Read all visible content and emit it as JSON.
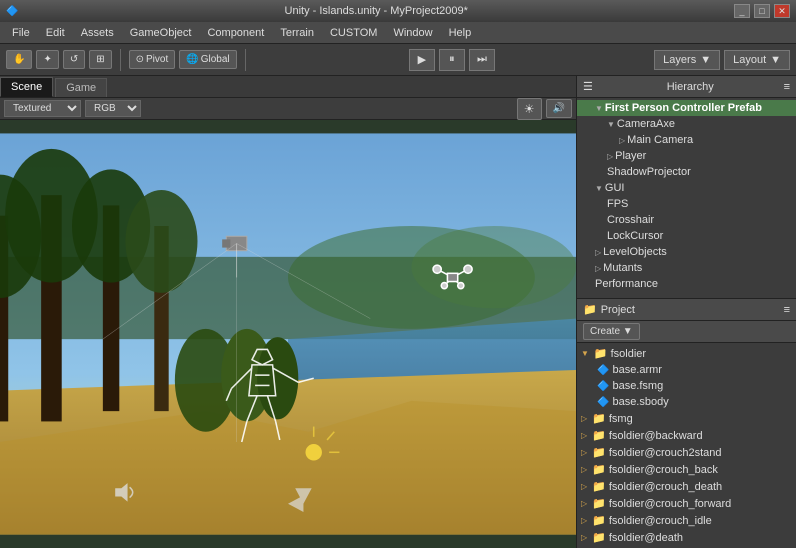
{
  "titlebar": {
    "title": "Unity - Islands.unity - MyProject2009*",
    "controls": [
      "_",
      "□",
      "✕"
    ]
  },
  "menubar": {
    "items": [
      "File",
      "Edit",
      "Assets",
      "GameObject",
      "Component",
      "Terrain",
      "CUSTOM",
      "Window",
      "Help"
    ]
  },
  "toolbar": {
    "tools": [
      "⊕",
      "✦",
      "↺",
      "⊞"
    ],
    "pivot_label": "Pivot",
    "global_label": "Global",
    "play_icon": "▶",
    "pause_icon": "❚❚",
    "step_icon": "▶|",
    "layers_label": "Layers",
    "layout_label": "Layout"
  },
  "left_panel": {
    "tabs": [
      "Scene",
      "Game"
    ],
    "scene_toolbar": {
      "shading": "Textured",
      "channel": "RGB"
    }
  },
  "hierarchy": {
    "title": "Hierarchy",
    "items": [
      {
        "label": "First Person Controller Prefab",
        "level": 0,
        "expanded": true,
        "is_root": true
      },
      {
        "label": "CameraAxe",
        "level": 1,
        "expanded": true
      },
      {
        "label": "Main Camera",
        "level": 2,
        "expanded": false
      },
      {
        "label": "Player",
        "level": 1,
        "expanded": false
      },
      {
        "label": "ShadowProjector",
        "level": 1,
        "expanded": false
      },
      {
        "label": "GUI",
        "level": 0,
        "expanded": true
      },
      {
        "label": "FPS",
        "level": 1,
        "expanded": false
      },
      {
        "label": "Crosshair",
        "level": 1,
        "expanded": false
      },
      {
        "label": "LockCursor",
        "level": 1,
        "expanded": false
      },
      {
        "label": "LevelObjects",
        "level": 0,
        "expanded": false
      },
      {
        "label": "Mutants",
        "level": 0,
        "expanded": false
      },
      {
        "label": "Performance",
        "level": 0,
        "expanded": false
      }
    ]
  },
  "project": {
    "title": "Project",
    "create_label": "Create ▼",
    "items": [
      {
        "label": "fsoldier",
        "level": 0,
        "is_folder": true,
        "expanded": true
      },
      {
        "label": "base.armr",
        "level": 1,
        "is_folder": false
      },
      {
        "label": "base.fsmg",
        "level": 1,
        "is_folder": false
      },
      {
        "label": "base.sbody",
        "level": 1,
        "is_folder": false
      },
      {
        "label": "fsmg",
        "level": 0,
        "is_folder": true,
        "expanded": false
      },
      {
        "label": "fsoldier@backward",
        "level": 0,
        "is_folder": true,
        "expanded": false
      },
      {
        "label": "fsoldier@crouch2stand",
        "level": 0,
        "is_folder": true,
        "expanded": false
      },
      {
        "label": "fsoldier@crouch_back",
        "level": 0,
        "is_folder": true,
        "expanded": false
      },
      {
        "label": "fsoldier@crouch_death",
        "level": 0,
        "is_folder": true,
        "expanded": false
      },
      {
        "label": "fsoldier@crouch_forward",
        "level": 0,
        "is_folder": true,
        "expanded": false
      },
      {
        "label": "fsoldier@crouch_idle",
        "level": 0,
        "is_folder": true,
        "expanded": false
      },
      {
        "label": "fsoldier@death",
        "level": 0,
        "is_folder": true,
        "expanded": false
      }
    ]
  }
}
